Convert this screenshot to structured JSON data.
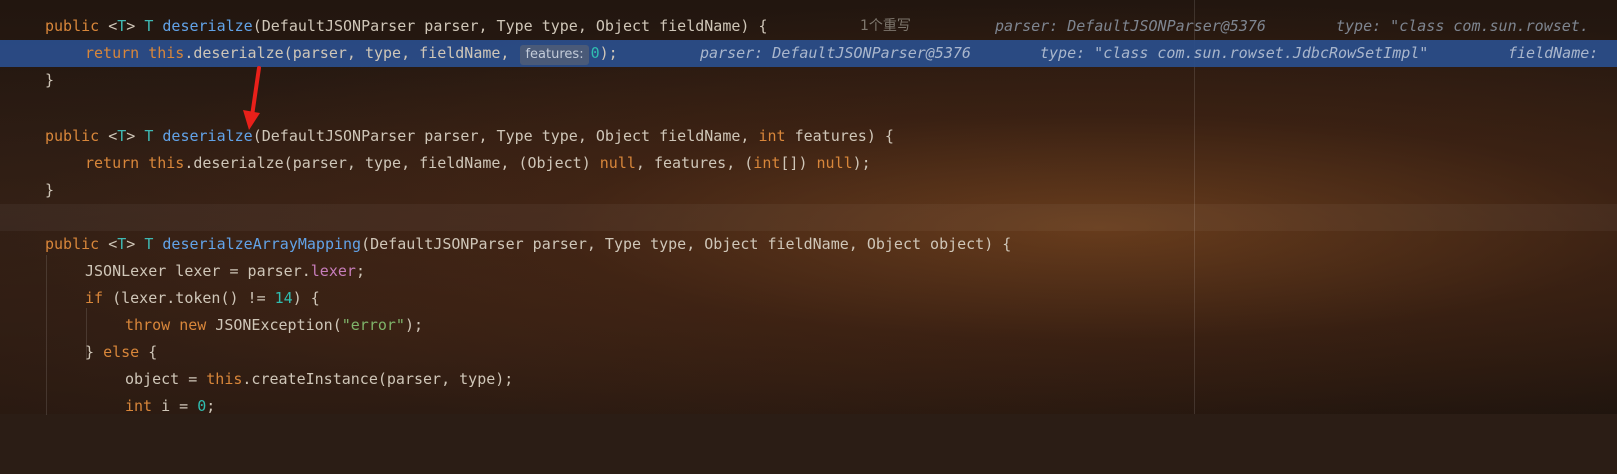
{
  "lines": [
    {
      "l1": "public",
      "l2": " <",
      "l3": "T",
      "l4": "> ",
      "l5": "T",
      "l6": " ",
      "l7": "deserialze",
      "l8": "(DefaultJSONParser parser, Type type, Object fieldName) {",
      "hint": "1个重写",
      "d1": "parser: DefaultJSONParser@5376",
      "d2": "type: \"class com.sun.rowset."
    },
    {
      "r1": "return",
      "r2": " ",
      "r3": "this",
      "r4": ".deserialze(parser, type, fieldName, ",
      "inlay": "features:",
      "r5": "0",
      "r6": ");",
      "d1": "parser: DefaultJSONParser@5376",
      "d2": "type: \"class com.sun.rowset.JdbcRowSetImpl\"",
      "d3": "fieldName:"
    },
    {
      "t": "}"
    },
    {
      "a1": "public",
      "a2": " <",
      "a3": "T",
      "a4": "> ",
      "a5": "T",
      "a6": " ",
      "a7": "deserialze",
      "a8": "(DefaultJSONParser parser, Type type, Object fieldName, ",
      "a9": "int",
      "a10": " features) {"
    },
    {
      "b1": "return",
      "b2": " ",
      "b3": "this",
      "b4": ".deserialze(parser, type, fieldName, (Object) ",
      "b5": "null",
      "b6": ", features, (",
      "b7": "int",
      "b8": "[]) ",
      "b9": "null",
      "b10": ");"
    },
    {
      "t": "}"
    },
    {
      "c1": "public",
      "c2": " <",
      "c3": "T",
      "c4": "> ",
      "c5": "T",
      "c6": " ",
      "c7": "deserialzeArrayMapping",
      "c8": "(DefaultJSONParser parser, Type type, Object fieldName, Object object) {"
    },
    {
      "e1": "JSONLexer lexer = parser.",
      "e2": "lexer",
      "e3": ";"
    },
    {
      "f1": "if",
      "f2": " (lexer.token() != ",
      "f3": "14",
      "f4": ") {"
    },
    {
      "g1": "throw",
      "g2": " ",
      "g3": "new",
      "g4": " JSONException(",
      "g5": "\"error\"",
      "g6": ");"
    },
    {
      "h1": "} ",
      "h2": "else",
      "h3": " {"
    },
    {
      "i1": "object = ",
      "i2": "this",
      "i3": ".createInstance(parser, type);"
    },
    {
      "j1": "int",
      "j2": " i = ",
      "j3": "0",
      "j4": ";"
    }
  ],
  "colors": {
    "keyword": "#d8863a",
    "function": "#62a3e8",
    "highlight": "#2a4e8c",
    "arrow": "#e8201a"
  }
}
